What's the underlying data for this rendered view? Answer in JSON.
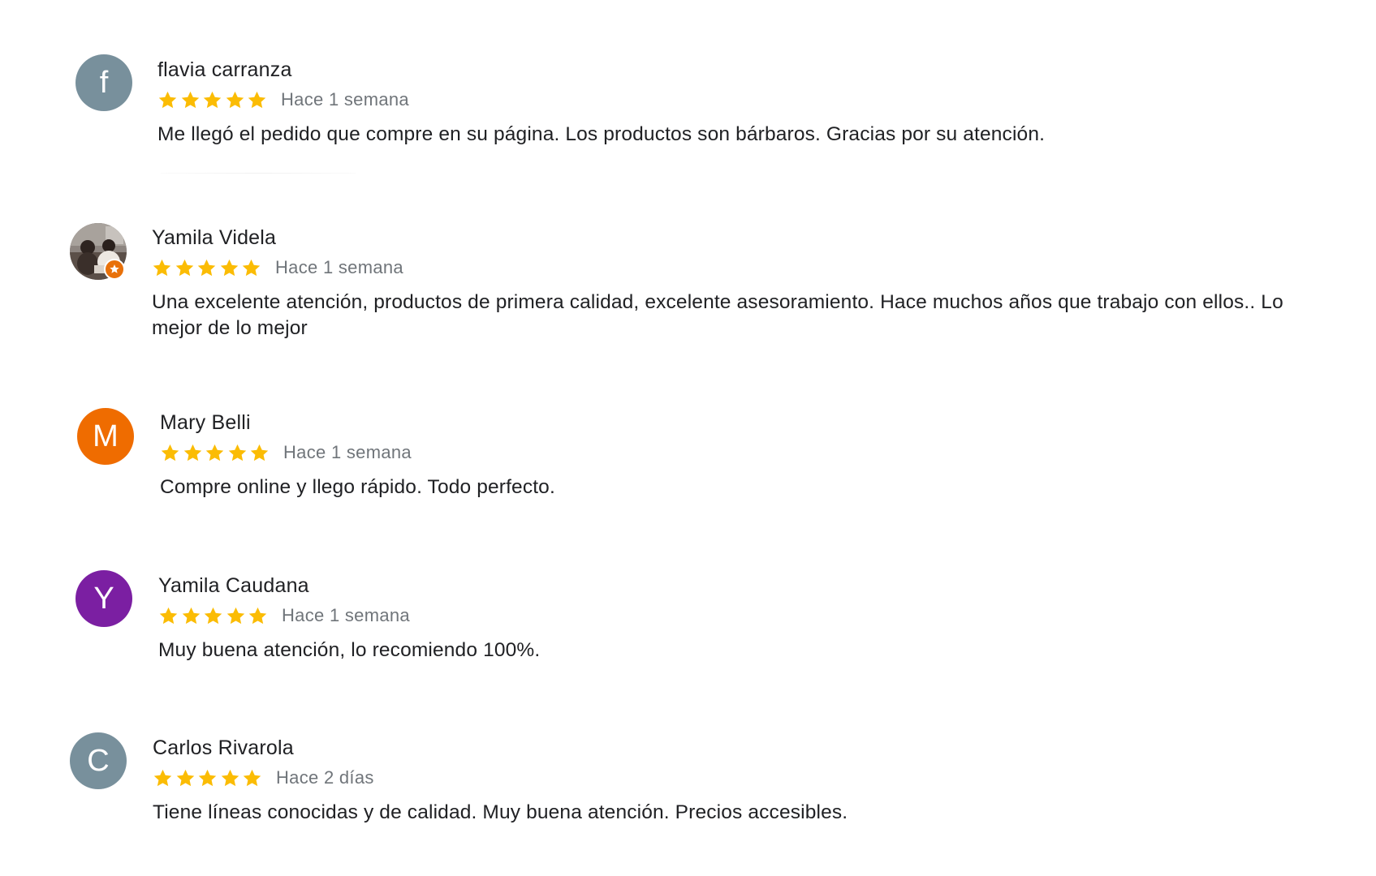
{
  "reviews": [
    {
      "name": "flavia carranza",
      "initial": "f",
      "avatar_color": "#78909c",
      "rating": 5,
      "date": "Hace 1 semana",
      "text": "Me llegó el pedido que compre en su página. Los productos son bárbaros. Gracias por su atención."
    },
    {
      "name": "Yamila Videla",
      "avatar_type": "photo",
      "avatar_badge": "local-guide-star",
      "rating": 5,
      "date": "Hace 1 semana",
      "text": "Una excelente atención, productos de primera calidad, excelente asesoramiento. Hace muchos años que trabajo con ellos.. Lo mejor de lo mejor"
    },
    {
      "name": "Mary Belli",
      "initial": "M",
      "avatar_color": "#ef6c00",
      "rating": 5,
      "date": "Hace 1 semana",
      "text": "Compre online y llego rápido. Todo perfecto."
    },
    {
      "name": "Yamila Caudana",
      "initial": "Y",
      "avatar_color": "#7b1fa2",
      "rating": 5,
      "date": "Hace 1 semana",
      "text": "Muy buena atención, lo recomiendo 100%."
    },
    {
      "name": "Carlos Rivarola",
      "initial": "C",
      "avatar_color": "#78909c",
      "rating": 5,
      "date": "Hace 2 días",
      "text": "Tiene líneas conocidas y de calidad. Muy buena atención. Precios accesibles."
    }
  ],
  "colors": {
    "star": "#fbbc04",
    "date": "#70757a",
    "text": "#202124"
  }
}
